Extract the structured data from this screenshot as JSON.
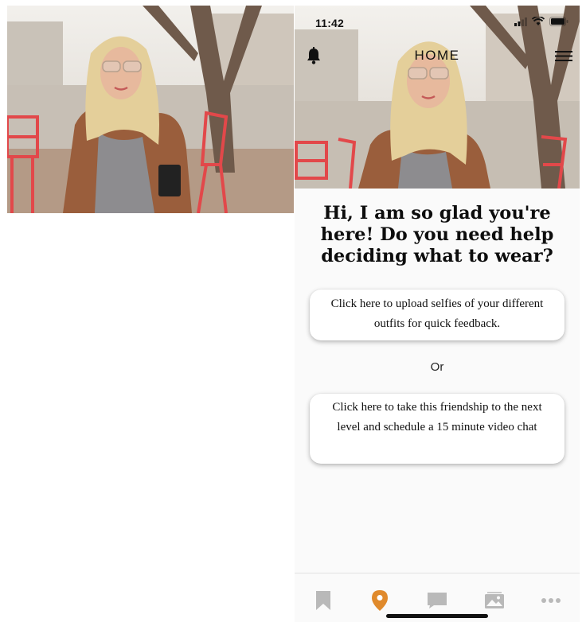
{
  "status_bar": {
    "time": "11:42"
  },
  "nav": {
    "title": "HOME",
    "bell_icon": "bell-icon",
    "menu_icon": "hamburger-menu-icon"
  },
  "main": {
    "headline": "Hi, I am so glad you're here! Do you need help deciding what to wear?",
    "upload_button_label": "Click here to upload selfies of your different outfits for quick feedback.",
    "separator": "Or",
    "video_chat_button_label": "Click here to take this friendship to the next level and schedule a 15 minute video chat"
  },
  "tabbar": {
    "tabs": [
      {
        "icon": "bookmark-icon",
        "active": false
      },
      {
        "icon": "location-pin-icon",
        "active": true
      },
      {
        "icon": "chat-bubble-icon",
        "active": false
      },
      {
        "icon": "photo-gallery-icon",
        "active": false
      },
      {
        "icon": "more-dots-icon",
        "active": false
      }
    ]
  },
  "colors": {
    "active_tab": "#e08a2c",
    "inactive_tab": "#b9b9b9",
    "chair_red": "#e2484a",
    "jacket_brown": "#9a5e3c"
  }
}
